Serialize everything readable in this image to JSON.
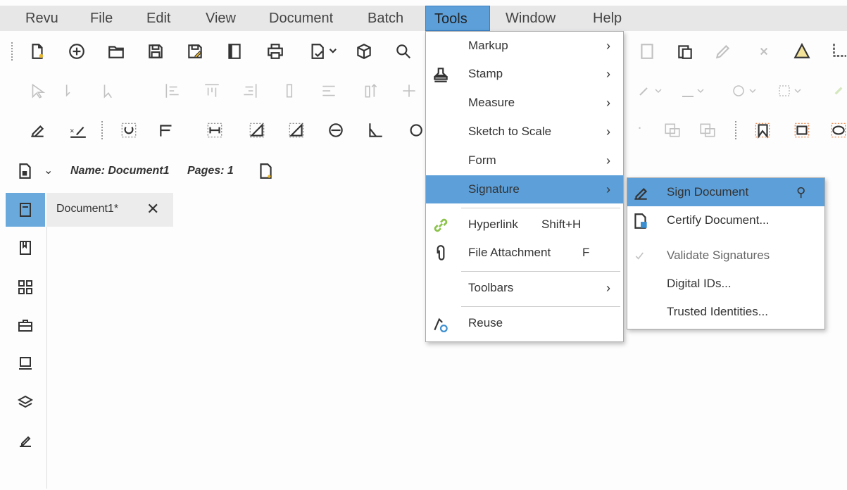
{
  "menubar": {
    "items": [
      "Revu",
      "File",
      "Edit",
      "View",
      "Document",
      "Batch",
      "Tools",
      "Window",
      "Help"
    ],
    "active": "Tools"
  },
  "toolbar": {
    "icons": [
      "new-document-icon",
      "add-icon",
      "open-folder-icon",
      "save-icon",
      "save-as-icon",
      "book-icon",
      "print-icon",
      "print-dropdown-icon",
      "3d-box-icon",
      "search-icon",
      "clipboard-icon",
      "warning-bell-icon",
      "crop-icon"
    ]
  },
  "docinfo": {
    "name_label": "Name: Document1",
    "pages_label": "Pages: 1"
  },
  "tab": {
    "title": "Document1*",
    "close": "✕"
  },
  "tools_menu": {
    "items": [
      {
        "label": "Markup",
        "arrow": "›"
      },
      {
        "label": "Stamp",
        "arrow": "›"
      },
      {
        "label": "Measure",
        "arrow": "›"
      },
      {
        "label": "Sketch to Scale",
        "arrow": "›"
      },
      {
        "label": "Form",
        "arrow": "›"
      },
      {
        "label": "Signature",
        "arrow": "›"
      },
      {
        "label": "Hyperlink",
        "shortcut": "Shift+H"
      },
      {
        "label": "File Attachment",
        "shortcut": "F"
      },
      {
        "label": "Toolbars",
        "arrow": "›"
      },
      {
        "label": "Reuse"
      }
    ],
    "highlighted": "Signature"
  },
  "signature_submenu": {
    "items": [
      {
        "label": "Sign Document"
      },
      {
        "label": "Certify Document..."
      },
      {
        "label": "Validate Signatures"
      },
      {
        "label": "Digital IDs..."
      },
      {
        "label": "Trusted Identities..."
      }
    ],
    "highlighted": "Sign Document"
  },
  "colors": {
    "menubar_bg": "#e7e7e8",
    "highlight": "#5c9fd9",
    "left_panel_active": "#6aa9dc",
    "accent_orange": "#e8702a",
    "hyperlink_green": "#8bc34a"
  }
}
